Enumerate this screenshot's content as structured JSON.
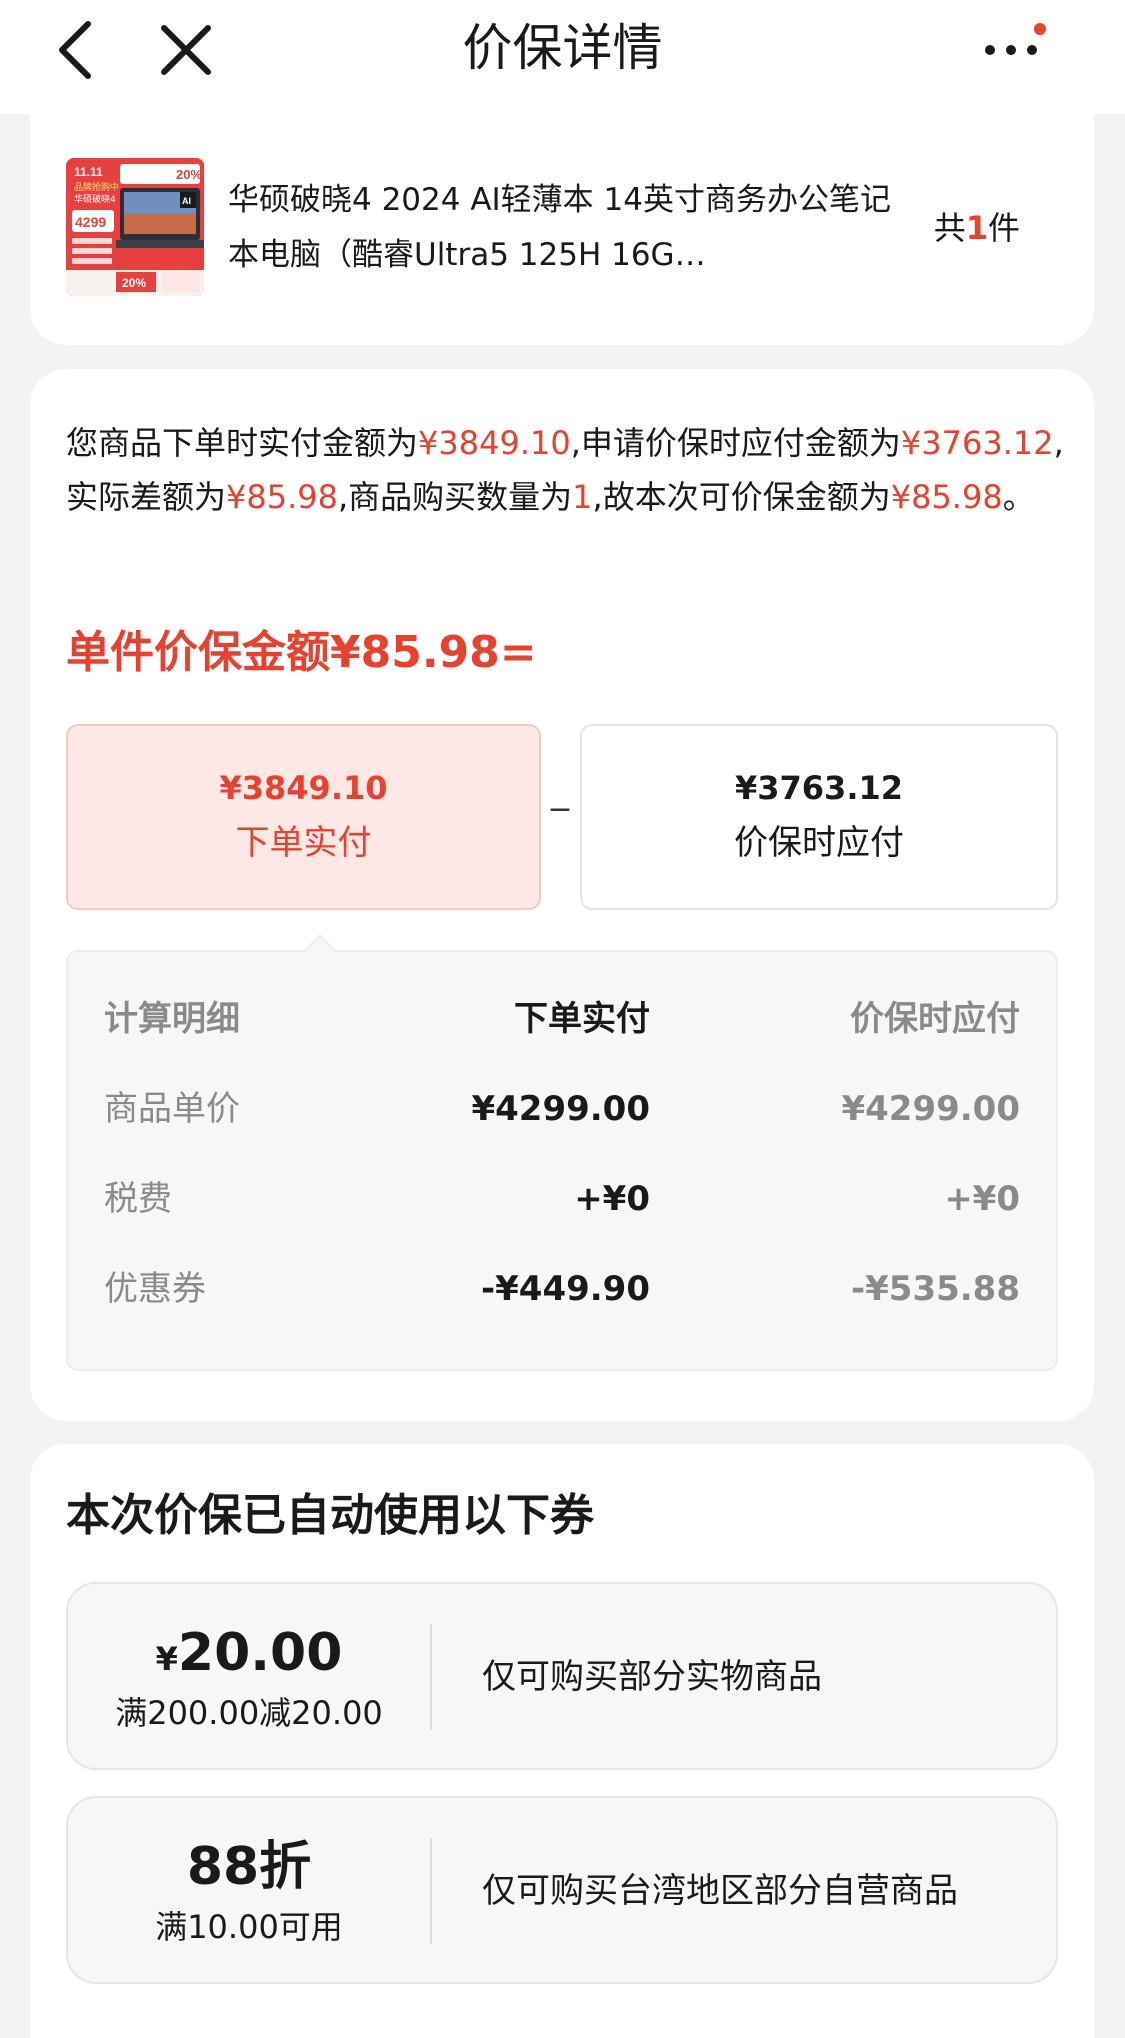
{
  "header": {
    "title": "价保详情",
    "back_icon": "chevron-left-icon",
    "close_icon": "close-icon",
    "more_icon": "more-horizontal-icon",
    "notification_dot_color": "#e8412f"
  },
  "product": {
    "name": "华硕破晓4 2024 AI轻薄本 14英寸商务办公笔记本电脑（酷睿Ultra5 125H 16G…",
    "qty_prefix": "共",
    "qty_value": "1",
    "qty_suffix": "件",
    "thumb": {
      "badge_11": "11.11",
      "badge_hot": "品牌抢购中",
      "badge_model": "华硕破晓4",
      "price": "4299",
      "discount": "20%",
      "ai_label": "AI"
    }
  },
  "explanation": {
    "t1": "您商品下单时实付金额为",
    "paid": "¥3849.10",
    "t2": ",申请价保时应付金额为",
    "due": "¥3763.12",
    "t3": ",实际差额为",
    "diff": "¥85.98",
    "t4": ",商品购买数量为",
    "qty": "1",
    "t5": ",故本次可价保金额为",
    "refund": "¥85.98",
    "t6": "。"
  },
  "unit_amount": "单件价保金额¥85.98=",
  "formula": {
    "paid_amount": "¥3849.10",
    "paid_label": "下单实付",
    "operator": "−",
    "due_amount": "¥3763.12",
    "due_label": "价保时应付"
  },
  "breakdown": {
    "headers": [
      "计算明细",
      "下单实付",
      "价保时应付"
    ],
    "rows": [
      [
        "商品单价",
        "¥4299.00",
        "¥4299.00"
      ],
      [
        "税费",
        "+¥0",
        "+¥0"
      ],
      [
        "优惠券",
        "-¥449.90",
        "-¥535.88"
      ]
    ]
  },
  "coupons": {
    "title": "本次价保已自动使用以下券",
    "items": [
      {
        "yen": "¥",
        "big": "20.00",
        "cond": "满200.00减20.00",
        "desc": "仅可购买部分实物商品"
      },
      {
        "yen": "",
        "big": "88折",
        "cond": "满10.00可用",
        "desc": "仅可购买台湾地区部分自营商品"
      }
    ]
  },
  "colors": {
    "accent": "#e8412f",
    "paid_box_bg": "#fde8e6",
    "page_bg": "#f3f3f3"
  }
}
